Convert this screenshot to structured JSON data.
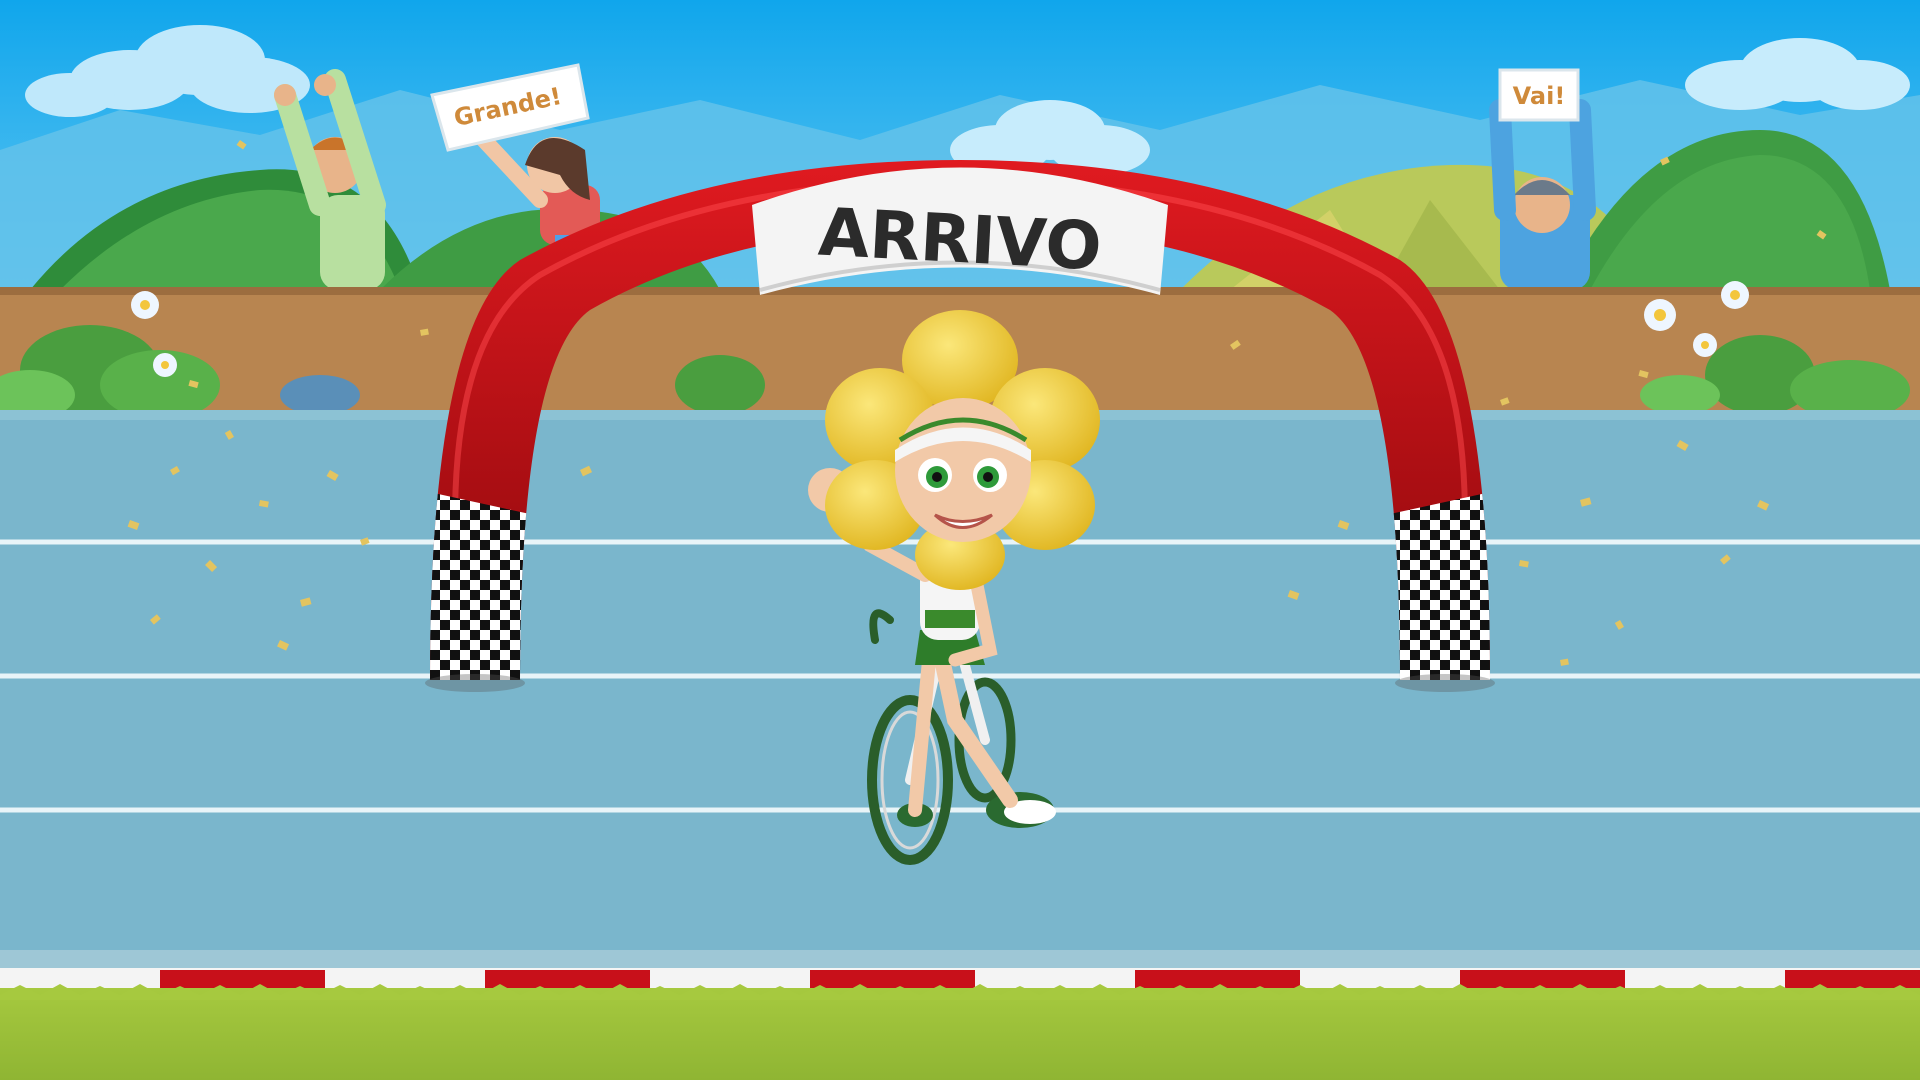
{
  "scene": {
    "finish_arch_label": "ARRIVO",
    "spectator_signs": [
      "Grande!",
      "Vai!"
    ]
  },
  "colors": {
    "sky_top": "#12a9ee",
    "sky_bottom": "#8ad6f5",
    "track": "#7ab6cc",
    "track_lines": "#e8f4f8",
    "wall": "#b88550",
    "arch_red": "#b80d12",
    "grass": "#9fc23a",
    "flower_yellow": "#f3d23c",
    "jersey_green": "#3a8a2c"
  },
  "icons": [
    "finish-arch-icon",
    "checkered-flag-icon",
    "cyclist-mascot-icon",
    "bicycle-icon",
    "spectator-icon",
    "cloud-icon",
    "hill-icon",
    "daisy-icon",
    "confetti-icon"
  ]
}
